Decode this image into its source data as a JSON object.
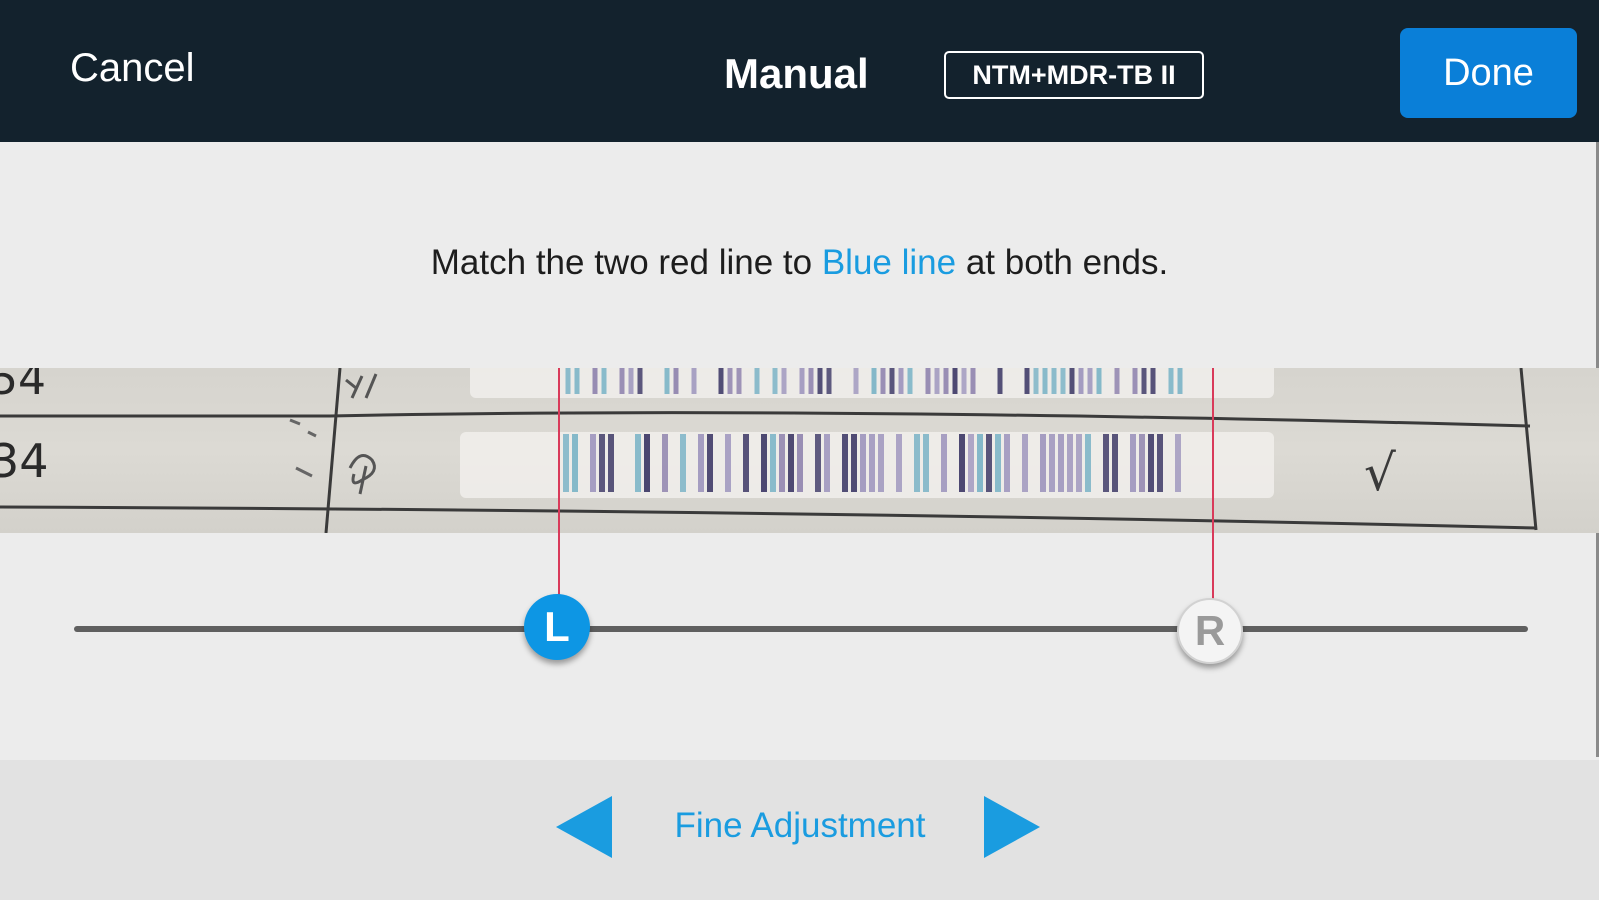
{
  "header": {
    "cancel_label": "Cancel",
    "title": "Manual",
    "kit_badge": "NTM+MDR-TB II",
    "done_label": "Done"
  },
  "instruction": {
    "before": "Match the two red line to ",
    "highlight": "Blue line",
    "after": " at both ends."
  },
  "strip_image": {
    "row_labels": [
      "54",
      "34"
    ],
    "check_mark": "√"
  },
  "slider": {
    "left_handle_label": "L",
    "right_handle_label": "R"
  },
  "footer": {
    "label": "Fine Adjustment",
    "left_icon": "triangle-left-icon",
    "right_icon": "triangle-right-icon"
  },
  "colors": {
    "topbar": "#13222d",
    "done_button": "#0a7fd8",
    "accent_blue": "#1a9ce0",
    "red_guide": "#d93a5a"
  }
}
